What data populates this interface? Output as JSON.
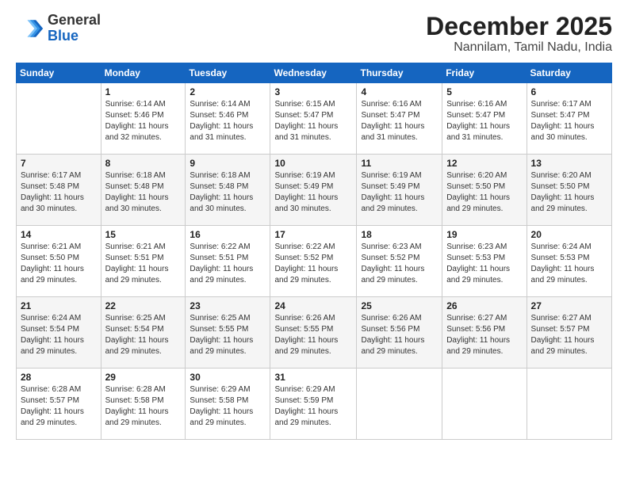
{
  "header": {
    "logo_general": "General",
    "logo_blue": "Blue",
    "main_title": "December 2025",
    "subtitle": "Nannilam, Tamil Nadu, India"
  },
  "calendar": {
    "days_of_week": [
      "Sunday",
      "Monday",
      "Tuesday",
      "Wednesday",
      "Thursday",
      "Friday",
      "Saturday"
    ],
    "weeks": [
      [
        {
          "day": "",
          "info": ""
        },
        {
          "day": "1",
          "info": "Sunrise: 6:14 AM\nSunset: 5:46 PM\nDaylight: 11 hours\nand 32 minutes."
        },
        {
          "day": "2",
          "info": "Sunrise: 6:14 AM\nSunset: 5:46 PM\nDaylight: 11 hours\nand 31 minutes."
        },
        {
          "day": "3",
          "info": "Sunrise: 6:15 AM\nSunset: 5:47 PM\nDaylight: 11 hours\nand 31 minutes."
        },
        {
          "day": "4",
          "info": "Sunrise: 6:16 AM\nSunset: 5:47 PM\nDaylight: 11 hours\nand 31 minutes."
        },
        {
          "day": "5",
          "info": "Sunrise: 6:16 AM\nSunset: 5:47 PM\nDaylight: 11 hours\nand 31 minutes."
        },
        {
          "day": "6",
          "info": "Sunrise: 6:17 AM\nSunset: 5:47 PM\nDaylight: 11 hours\nand 30 minutes."
        }
      ],
      [
        {
          "day": "7",
          "info": "Sunrise: 6:17 AM\nSunset: 5:48 PM\nDaylight: 11 hours\nand 30 minutes."
        },
        {
          "day": "8",
          "info": "Sunrise: 6:18 AM\nSunset: 5:48 PM\nDaylight: 11 hours\nand 30 minutes."
        },
        {
          "day": "9",
          "info": "Sunrise: 6:18 AM\nSunset: 5:48 PM\nDaylight: 11 hours\nand 30 minutes."
        },
        {
          "day": "10",
          "info": "Sunrise: 6:19 AM\nSunset: 5:49 PM\nDaylight: 11 hours\nand 30 minutes."
        },
        {
          "day": "11",
          "info": "Sunrise: 6:19 AM\nSunset: 5:49 PM\nDaylight: 11 hours\nand 29 minutes."
        },
        {
          "day": "12",
          "info": "Sunrise: 6:20 AM\nSunset: 5:50 PM\nDaylight: 11 hours\nand 29 minutes."
        },
        {
          "day": "13",
          "info": "Sunrise: 6:20 AM\nSunset: 5:50 PM\nDaylight: 11 hours\nand 29 minutes."
        }
      ],
      [
        {
          "day": "14",
          "info": "Sunrise: 6:21 AM\nSunset: 5:50 PM\nDaylight: 11 hours\nand 29 minutes."
        },
        {
          "day": "15",
          "info": "Sunrise: 6:21 AM\nSunset: 5:51 PM\nDaylight: 11 hours\nand 29 minutes."
        },
        {
          "day": "16",
          "info": "Sunrise: 6:22 AM\nSunset: 5:51 PM\nDaylight: 11 hours\nand 29 minutes."
        },
        {
          "day": "17",
          "info": "Sunrise: 6:22 AM\nSunset: 5:52 PM\nDaylight: 11 hours\nand 29 minutes."
        },
        {
          "day": "18",
          "info": "Sunrise: 6:23 AM\nSunset: 5:52 PM\nDaylight: 11 hours\nand 29 minutes."
        },
        {
          "day": "19",
          "info": "Sunrise: 6:23 AM\nSunset: 5:53 PM\nDaylight: 11 hours\nand 29 minutes."
        },
        {
          "day": "20",
          "info": "Sunrise: 6:24 AM\nSunset: 5:53 PM\nDaylight: 11 hours\nand 29 minutes."
        }
      ],
      [
        {
          "day": "21",
          "info": "Sunrise: 6:24 AM\nSunset: 5:54 PM\nDaylight: 11 hours\nand 29 minutes."
        },
        {
          "day": "22",
          "info": "Sunrise: 6:25 AM\nSunset: 5:54 PM\nDaylight: 11 hours\nand 29 minutes."
        },
        {
          "day": "23",
          "info": "Sunrise: 6:25 AM\nSunset: 5:55 PM\nDaylight: 11 hours\nand 29 minutes."
        },
        {
          "day": "24",
          "info": "Sunrise: 6:26 AM\nSunset: 5:55 PM\nDaylight: 11 hours\nand 29 minutes."
        },
        {
          "day": "25",
          "info": "Sunrise: 6:26 AM\nSunset: 5:56 PM\nDaylight: 11 hours\nand 29 minutes."
        },
        {
          "day": "26",
          "info": "Sunrise: 6:27 AM\nSunset: 5:56 PM\nDaylight: 11 hours\nand 29 minutes."
        },
        {
          "day": "27",
          "info": "Sunrise: 6:27 AM\nSunset: 5:57 PM\nDaylight: 11 hours\nand 29 minutes."
        }
      ],
      [
        {
          "day": "28",
          "info": "Sunrise: 6:28 AM\nSunset: 5:57 PM\nDaylight: 11 hours\nand 29 minutes."
        },
        {
          "day": "29",
          "info": "Sunrise: 6:28 AM\nSunset: 5:58 PM\nDaylight: 11 hours\nand 29 minutes."
        },
        {
          "day": "30",
          "info": "Sunrise: 6:29 AM\nSunset: 5:58 PM\nDaylight: 11 hours\nand 29 minutes."
        },
        {
          "day": "31",
          "info": "Sunrise: 6:29 AM\nSunset: 5:59 PM\nDaylight: 11 hours\nand 29 minutes."
        },
        {
          "day": "",
          "info": ""
        },
        {
          "day": "",
          "info": ""
        },
        {
          "day": "",
          "info": ""
        }
      ]
    ]
  }
}
